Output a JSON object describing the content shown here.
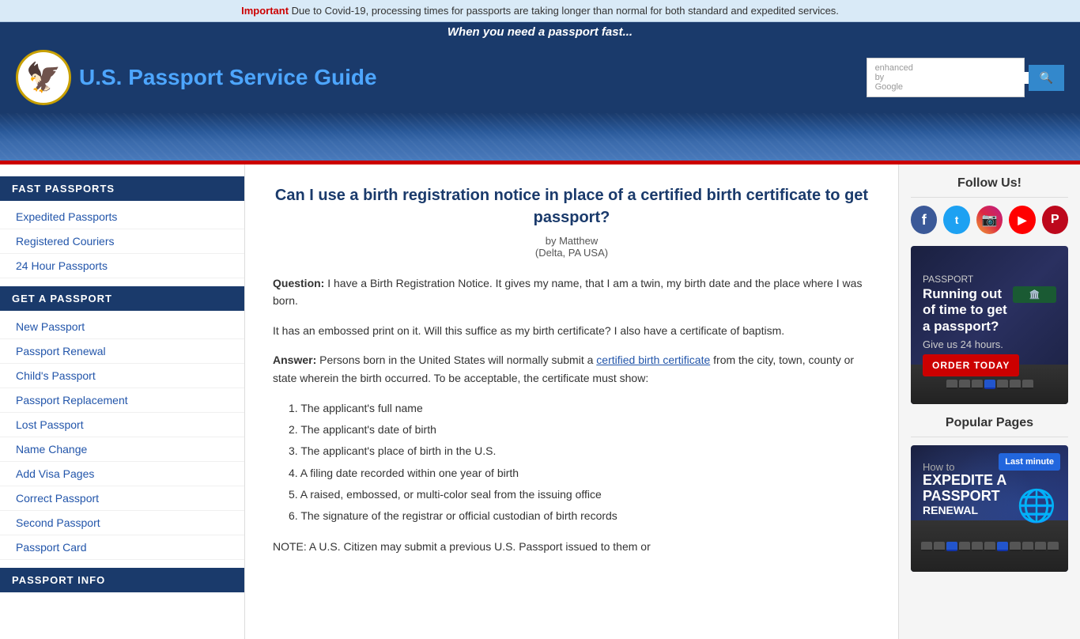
{
  "alert": {
    "important_label": "Important",
    "message": " Due to Covid-19, processing times for passports are taking longer than normal for both standard and expedited services."
  },
  "header": {
    "tagline": "When you need a passport fast...",
    "logo_text": "U.S. Passport Service Guide",
    "search_placeholder": "enhanced by Google",
    "search_button_label": "🔍"
  },
  "sidebar": {
    "fast_passports_title": "FAST PASSPORTS",
    "fast_passports_links": [
      {
        "label": "Expedited Passports",
        "href": "#"
      },
      {
        "label": "Registered Couriers",
        "href": "#"
      },
      {
        "label": "24 Hour Passports",
        "href": "#"
      }
    ],
    "get_passport_title": "GET A PASSPORT",
    "get_passport_links": [
      {
        "label": "New Passport",
        "href": "#"
      },
      {
        "label": "Passport Renewal",
        "href": "#"
      },
      {
        "label": "Child's Passport",
        "href": "#"
      },
      {
        "label": "Passport Replacement",
        "href": "#"
      },
      {
        "label": "Lost Passport",
        "href": "#"
      },
      {
        "label": "Name Change",
        "href": "#"
      },
      {
        "label": "Add Visa Pages",
        "href": "#"
      },
      {
        "label": "Correct Passport",
        "href": "#"
      },
      {
        "label": "Second Passport",
        "href": "#"
      },
      {
        "label": "Passport Card",
        "href": "#"
      }
    ],
    "passport_info_title": "PASSPORT INFO"
  },
  "content": {
    "title": "Can I use a birth registration notice in place of a certified birth certificate to get passport?",
    "author": "by Matthew",
    "location": "(Delta, PA USA)",
    "question_label": "Question:",
    "question_text": " I have a Birth Registration Notice. It gives my name, that I am a twin, my birth date and the place where I was born.",
    "question_text2": "It has an embossed print on it. Will this suffice as my birth certificate? I also have a certificate of baptism.",
    "answer_label": "Answer:",
    "answer_text": " Persons born in the United States will normally submit a ",
    "answer_link": "certified birth certificate",
    "answer_text2": " from the city, town, county or state wherein the birth occurred. To be acceptable, the certificate must show:",
    "list_items": [
      "1. The applicant's full name",
      "2. The applicant's date of birth",
      "3. The applicant's place of birth in the U.S.",
      "4. A filing date recorded within one year of birth",
      "5. A raised, embossed, or multi-color seal from the issuing office",
      "6. The signature of the registrar or official custodian of birth records"
    ],
    "note_text": "NOTE: A U.S. Citizen may submit a previous U.S. Passport issued to them or"
  },
  "right_sidebar": {
    "follow_us_title": "Follow Us!",
    "social_icons": [
      {
        "name": "facebook",
        "class": "social-facebook",
        "symbol": "f"
      },
      {
        "name": "twitter",
        "class": "social-twitter",
        "symbol": "t"
      },
      {
        "name": "instagram",
        "class": "social-instagram",
        "symbol": "📷"
      },
      {
        "name": "youtube",
        "class": "social-youtube",
        "symbol": "▶"
      },
      {
        "name": "pinterest",
        "class": "social-pinterest",
        "symbol": "P"
      }
    ],
    "ad_banner": {
      "line1": "Running out",
      "line2": "of time to get",
      "line3": "a passport?",
      "sub": "Give us 24 hours.",
      "button_label": "ORDER TODAY"
    },
    "popular_pages_title": "Popular Pages",
    "popular_thumb": {
      "how_text": "How to",
      "title_text": "EXPEDITE A PASSPORT",
      "renewal_text": "RENEWAL",
      "last_text": "Last minute"
    }
  }
}
